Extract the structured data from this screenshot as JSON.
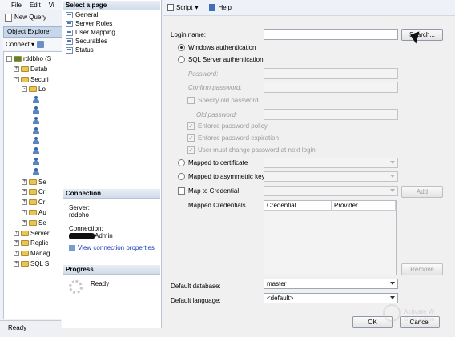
{
  "ssms": {
    "menu": [
      "File",
      "Edit",
      "Vi"
    ],
    "new_query": "New Query",
    "object_explorer_title": "Object Explorer",
    "connect_label": "Connect ▾",
    "tree": [
      {
        "label": "rddbho (S",
        "exp": "-",
        "type": "server"
      },
      {
        "label": "Datab",
        "exp": "+",
        "type": "folder"
      },
      {
        "label": "Securi",
        "exp": "-",
        "type": "folder"
      },
      {
        "label": "Lo",
        "exp": "-",
        "type": "folder"
      },
      {
        "label": "",
        "exp": "",
        "type": "user"
      },
      {
        "label": "",
        "exp": "",
        "type": "user"
      },
      {
        "label": "",
        "exp": "",
        "type": "user"
      },
      {
        "label": "",
        "exp": "",
        "type": "user"
      },
      {
        "label": "",
        "exp": "",
        "type": "user"
      },
      {
        "label": "",
        "exp": "",
        "type": "user"
      },
      {
        "label": "",
        "exp": "",
        "type": "user"
      },
      {
        "label": "",
        "exp": "",
        "type": "user"
      },
      {
        "label": "Se",
        "exp": "+",
        "type": "folder"
      },
      {
        "label": "Cr",
        "exp": "+",
        "type": "folder"
      },
      {
        "label": "Cr",
        "exp": "+",
        "type": "folder"
      },
      {
        "label": "Au",
        "exp": "+",
        "type": "folder"
      },
      {
        "label": "Se",
        "exp": "+",
        "type": "folder"
      },
      {
        "label": "Server",
        "exp": "+",
        "type": "folder"
      },
      {
        "label": "Replic",
        "exp": "+",
        "type": "folder"
      },
      {
        "label": "Manag",
        "exp": "+",
        "type": "folder"
      },
      {
        "label": "SQL S",
        "exp": "+",
        "type": "folder"
      }
    ],
    "status": "Ready"
  },
  "dialog": {
    "select_page_header": "Select a page",
    "pages": [
      "General",
      "Server Roles",
      "User Mapping",
      "Securables",
      "Status"
    ],
    "connection_header": "Connection",
    "server_label": "Server:",
    "server_value": "rddbho",
    "connection_label": "Connection:",
    "connection_value_suffix": "Admin",
    "view_connection_link": "View connection properties",
    "progress_header": "Progress",
    "progress_status": "Ready",
    "toolbar": {
      "script": "Script",
      "help": "Help"
    },
    "login_name_label": "Login name:",
    "login_name_value": "",
    "search_button": "Search...",
    "windows_auth": "Windows authentication",
    "sql_auth": "SQL Server authentication",
    "password_label": "Password:",
    "confirm_password_label": "Confirm password:",
    "specify_old_password": "Specify old password",
    "old_password_label": "Old password:",
    "enforce_policy": "Enforce password policy",
    "enforce_expiration": "Enforce password expiration",
    "must_change": "User must change password at next login",
    "mapped_certificate": "Mapped to certificate",
    "mapped_asym_key": "Mapped to asymmetric key",
    "map_credential": "Map to Credential",
    "add_button": "Add",
    "mapped_credentials_label": "Mapped Credentials",
    "grid_columns": [
      "Credential",
      "Provider"
    ],
    "remove_button": "Remove",
    "default_database_label": "Default database:",
    "default_database_value": "master",
    "default_language_label": "Default language:",
    "default_language_value": "<default>",
    "ok_button": "OK",
    "cancel_button": "Cancel"
  },
  "watermark": {
    "line1": "Activate W",
    "line2": "Go to Action"
  }
}
